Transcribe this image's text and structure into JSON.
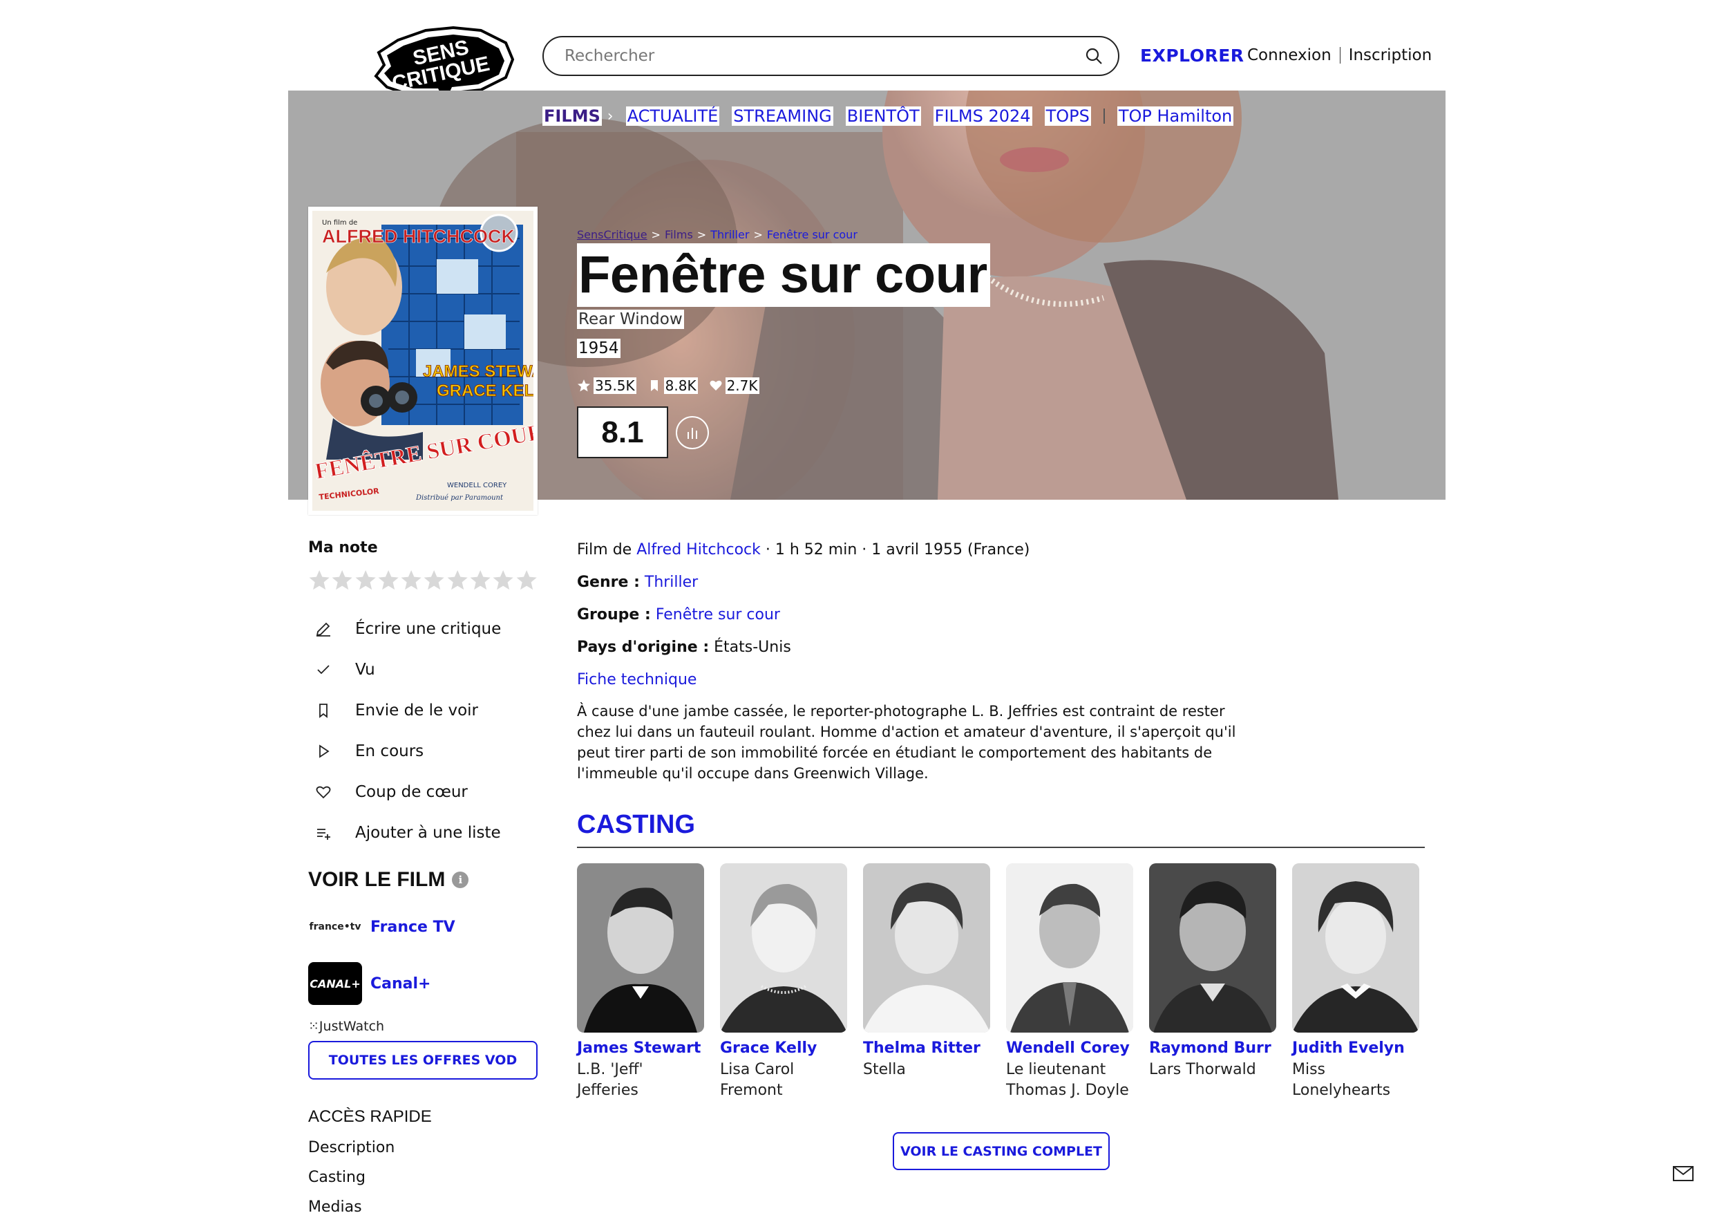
{
  "header": {
    "logo_line1": "SENS",
    "logo_line2": "CRITIQUE",
    "search_placeholder": "Rechercher",
    "explorer": "EXPLORER",
    "login": "Connexion",
    "signup": "Inscription"
  },
  "nav": {
    "films": "FILMS",
    "items": [
      "ACTUALITÉ",
      "STREAMING",
      "BIENTÔT",
      "FILMS 2024",
      "TOPS"
    ],
    "top": "TOP Hamilton"
  },
  "breadcrumb": [
    "SensCritique",
    "Films",
    "Thriller",
    "Fenêtre sur cour"
  ],
  "film": {
    "title": "Fenêtre sur cour",
    "original_title": "Rear Window",
    "year": "1954",
    "ratings_count": "35.5K",
    "wishes_count": "8.8K",
    "favorites_count": "2.7K",
    "score": "8.1",
    "meta_prefix": "Film de ",
    "director": "Alfred Hitchcock",
    "meta_suffix": " · 1 h 52 min · 1 avril 1955 (France)",
    "genre_label": "Genre :",
    "genre": "Thriller",
    "group_label": "Groupe :",
    "group": "Fenêtre sur cour",
    "country_label": "Pays d'origine :",
    "country": "États-Unis",
    "fiche": "Fiche technique",
    "description": "À cause d'une jambe cassée, le reporter-photographe L. B. Jeffries est contraint de rester chez lui dans un fauteuil roulant. Homme d'action et amateur d'aventure, il s'aperçoit qu'il peut tirer parti de son immobilité forcée en étudiant le comportement des habitants de l'immeuble qu'il occupe dans Greenwich Village."
  },
  "poster": {
    "top_text": "Un film de",
    "director": "ALFRED HITCHCOCK",
    "actor1": "JAMES STEWART",
    "actor2": "GRACE KELLY",
    "title": "FENÊTRE SUR COUR",
    "technicolor": "TECHNICOLOR",
    "corey": "WENDELL COREY",
    "distrib": "Distribué par Paramount"
  },
  "sidebar": {
    "ma_note": "Ma note",
    "actions": [
      {
        "label": "Écrire une critique",
        "icon": "pencil-icon"
      },
      {
        "label": "Vu",
        "icon": "check-icon"
      },
      {
        "label": "Envie de le voir",
        "icon": "bookmark-icon"
      },
      {
        "label": "En cours",
        "icon": "play-icon"
      },
      {
        "label": "Coup de cœur",
        "icon": "heart-icon"
      },
      {
        "label": "Ajouter à une liste",
        "icon": "list-add-icon"
      }
    ],
    "voir_le_film": "VOIR LE FILM",
    "providers": [
      {
        "logo": "france•tv",
        "name": "France TV"
      },
      {
        "logo": "CANAL+",
        "name": "Canal+"
      }
    ],
    "justwatch": "JustWatch",
    "vod_button": "TOUTES LES OFFRES VOD",
    "acces_rapide": "ACCÈS RAPIDE",
    "quick_links": [
      "Description",
      "Casting",
      "Medias"
    ]
  },
  "casting": {
    "heading": "CASTING",
    "actors": [
      {
        "name": "James Stewart",
        "role": "L.B. 'Jeff' Jefferies"
      },
      {
        "name": "Grace Kelly",
        "role": "Lisa Carol Fremont"
      },
      {
        "name": "Thelma Ritter",
        "role": "Stella"
      },
      {
        "name": "Wendell Corey",
        "role": "Le lieutenant Thomas J. Doyle"
      },
      {
        "name": "Raymond Burr",
        "role": "Lars Thorwald"
      },
      {
        "name": "Judith Evelyn",
        "role": "Miss Lonelyhearts"
      }
    ],
    "full_button": "VOIR LE CASTING COMPLET"
  },
  "colors": {
    "accent": "#1a1adc",
    "films_nav": "#3b1e86",
    "hero_overlay": "#a9a9a9"
  }
}
